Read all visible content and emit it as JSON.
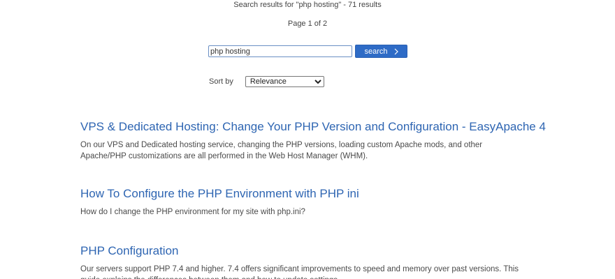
{
  "header": {
    "summary": "Search results for \"php hosting\" - 71 results",
    "pager": "Page 1 of 2"
  },
  "search": {
    "value": "php hosting",
    "button_label": "search"
  },
  "sort": {
    "label": "Sort by",
    "selected": "Relevance"
  },
  "results": [
    {
      "title": "VPS & Dedicated Hosting: Change Your PHP Version and Configuration - EasyApache 4",
      "snippet": "On our VPS and Dedicated hosting service, changing the PHP versions, loading custom Apache mods, and other Apache/PHP customizations are all performed in the Web Host Manager (WHM)."
    },
    {
      "title": "How To Configure the PHP Environment with PHP ini",
      "snippet": "How do I change the PHP environment for my site with php.ini?"
    },
    {
      "title": "PHP Configuration",
      "snippet": "Our servers support PHP 7.4 and higher. 7.4 offers significant improvements to speed and memory over past versions. This guide explains the differences between them and how to update settings."
    }
  ],
  "colors": {
    "link": "#2e65b2",
    "button": "#2e6bc6"
  },
  "icons": {
    "button_icon": "chevron-right-icon"
  }
}
